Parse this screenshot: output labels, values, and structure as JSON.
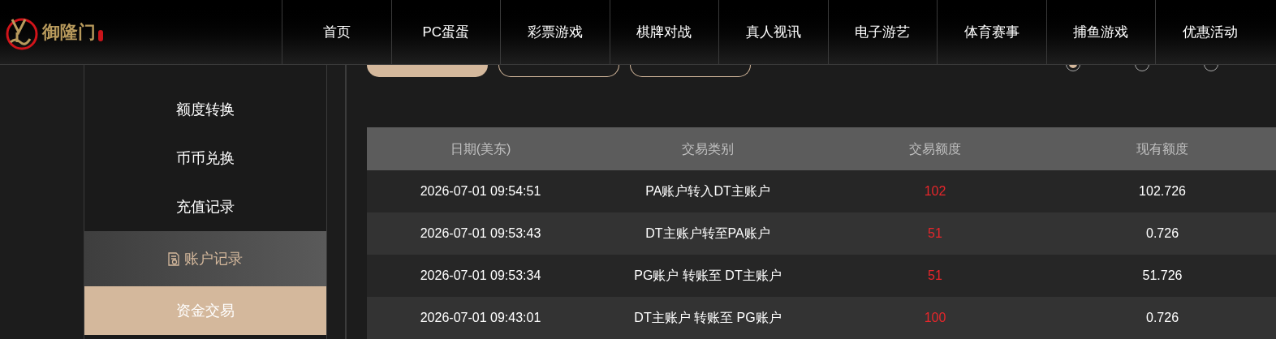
{
  "header": {
    "logo_text": "御隆门",
    "nav": [
      {
        "label": "首页"
      },
      {
        "label": "PC蛋蛋"
      },
      {
        "label": "彩票游戏"
      },
      {
        "label": "棋牌对战"
      },
      {
        "label": "真人视讯"
      },
      {
        "label": "电子游艺"
      },
      {
        "label": "体育赛事"
      },
      {
        "label": "捕鱼游戏"
      },
      {
        "label": "优惠活动"
      }
    ]
  },
  "sidebar": {
    "items": [
      {
        "label": "额度转换",
        "kind": "item",
        "selected": false
      },
      {
        "label": "币币兑换",
        "kind": "item",
        "selected": false
      },
      {
        "label": "充值记录",
        "kind": "item",
        "selected": false
      },
      {
        "label": "账户记录",
        "kind": "group",
        "selected": false
      },
      {
        "label": "资金交易",
        "kind": "item",
        "selected": true
      }
    ]
  },
  "filters": [
    {
      "selected": true
    },
    {
      "selected": false
    },
    {
      "selected": false
    }
  ],
  "range_options": [
    {
      "selected": true
    },
    {
      "selected": false
    },
    {
      "selected": false
    }
  ],
  "table": {
    "columns": [
      "日期(美东)",
      "交易类别",
      "交易额度",
      "现有额度"
    ],
    "rows": [
      [
        "2026-07-01 09:54:51",
        "PA账户转入DT主账户",
        "102",
        "102.726"
      ],
      [
        "2026-07-01 09:53:43",
        "DT主账户转至PA账户",
        "51",
        "0.726"
      ],
      [
        "2026-07-01 09:53:34",
        "PG账户 转账至 DT主账户",
        "51",
        "51.726"
      ],
      [
        "2026-07-01 09:43:01",
        "DT主账户 转账至 PG账户",
        "100",
        "0.726"
      ]
    ]
  }
}
